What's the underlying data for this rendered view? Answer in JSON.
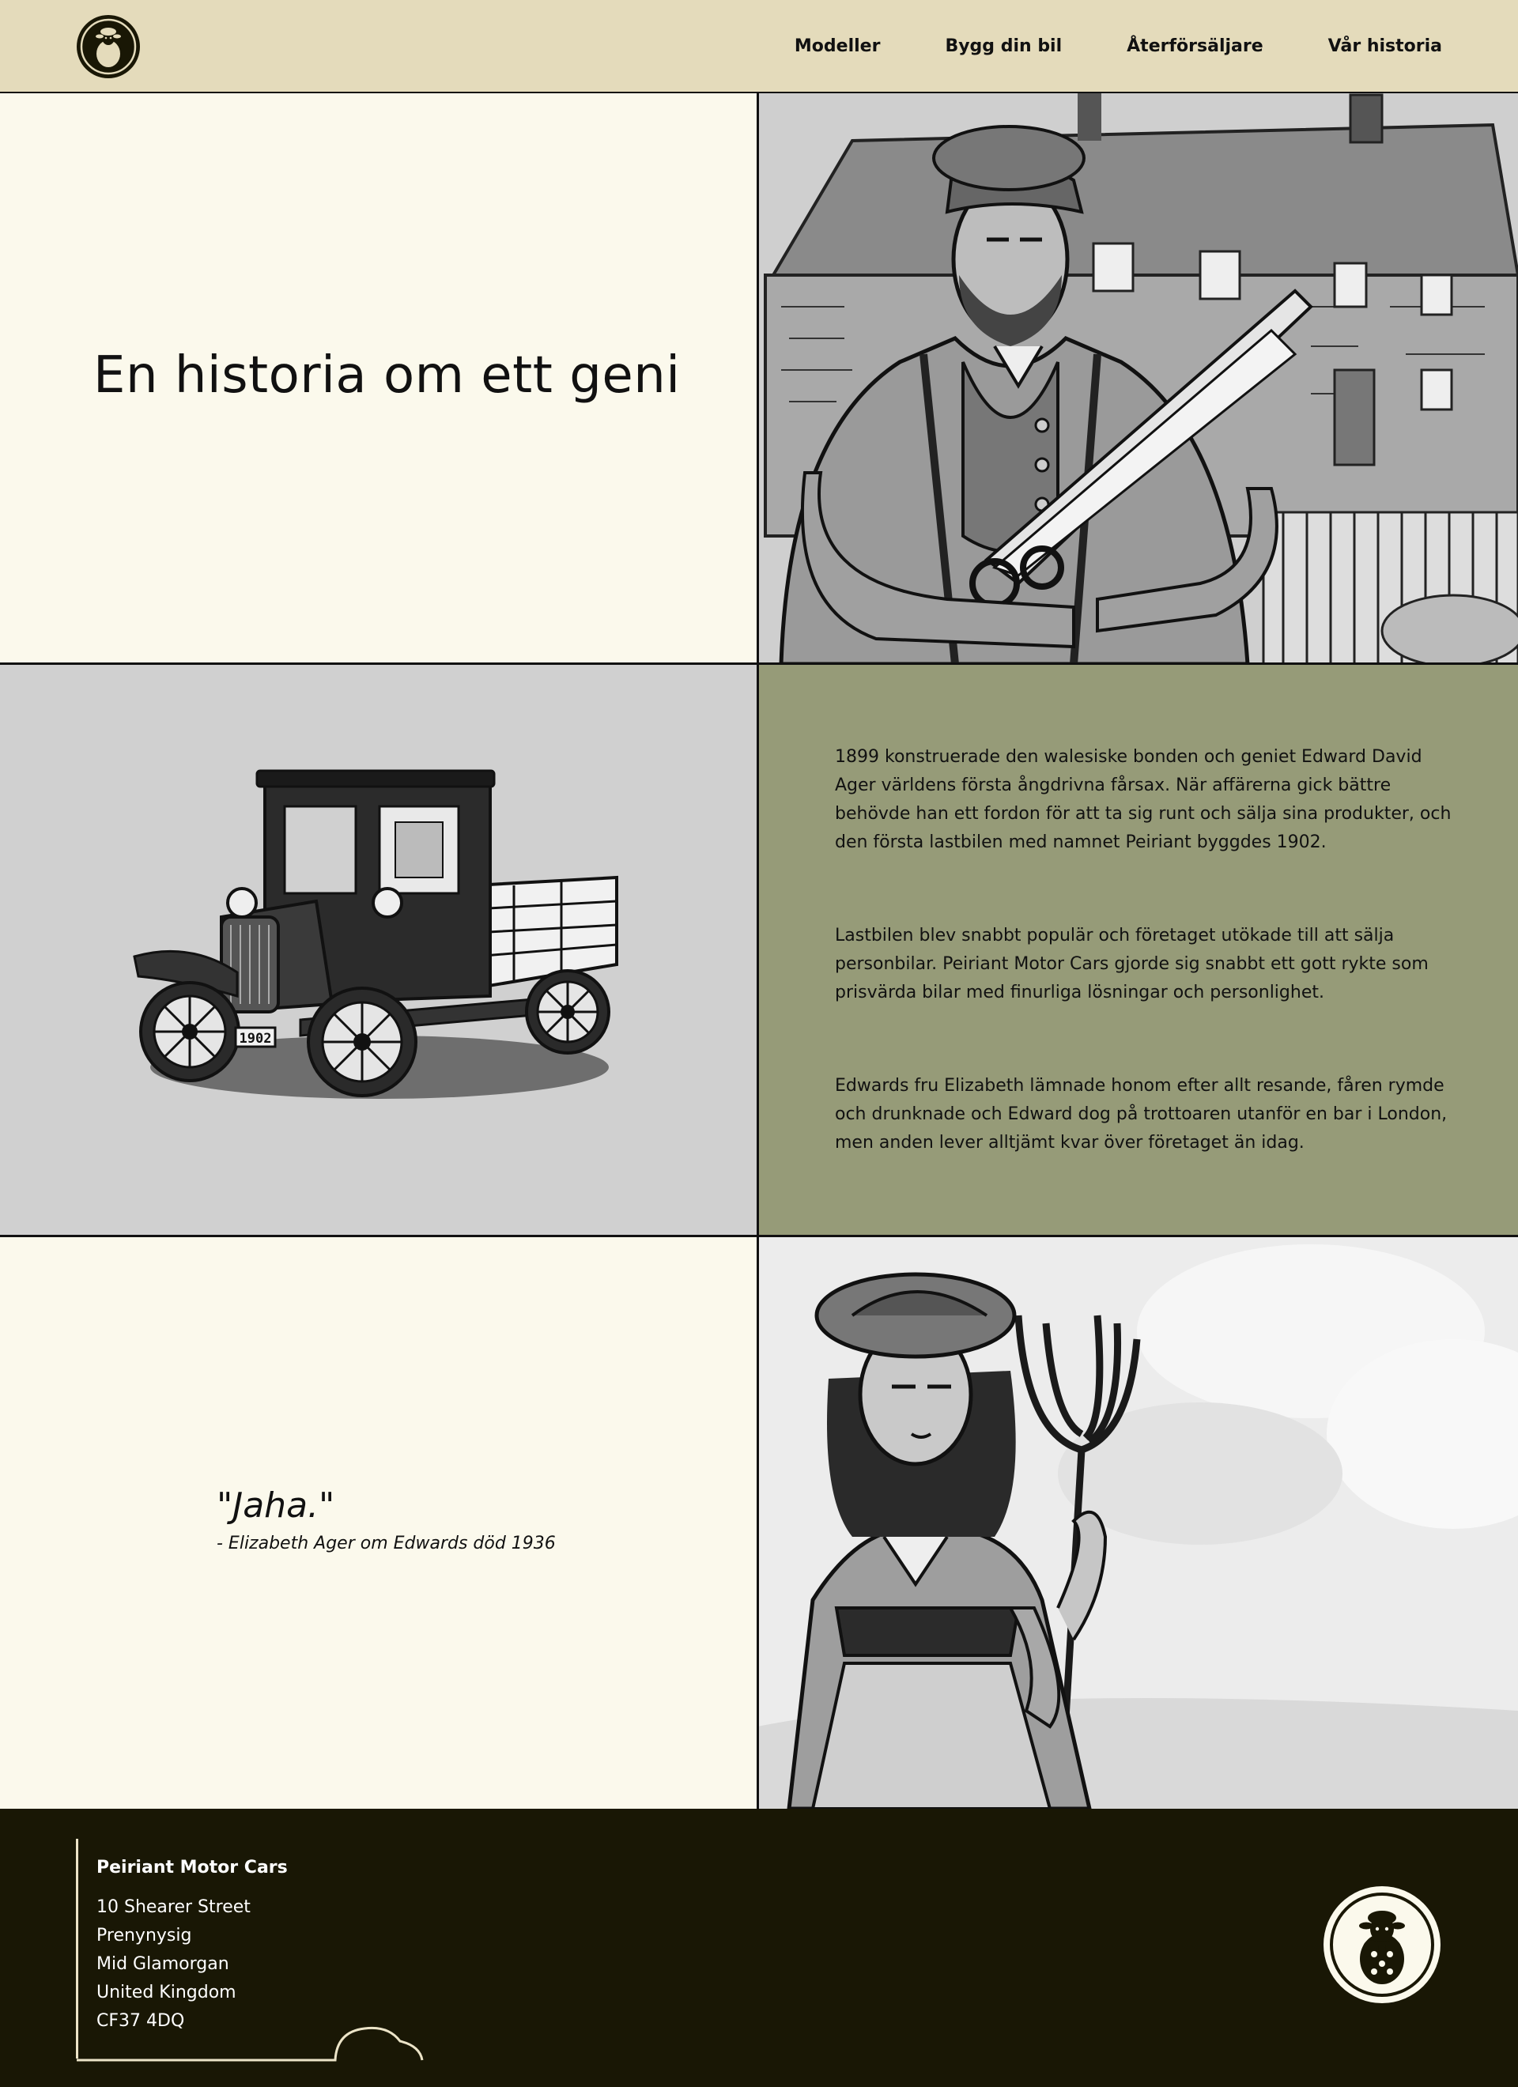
{
  "nav": {
    "logo_icon": "sheep-logo-icon",
    "links": [
      "Modeller",
      "Bygg din bil",
      "Återförsäljare",
      "Vår historia"
    ]
  },
  "hero": {
    "title": "En historia om ett geni",
    "image": "farmer-with-shears-illustration"
  },
  "story": {
    "image": "vintage-truck-1902-illustration",
    "plate": "1902",
    "paragraphs": [
      "1899 konstruerade den walesiske bonden och geniet Edward David Ager världens första ångdrivna fårsax. När affärerna gick bättre behövde han ett fordon för att ta sig runt och sälja sina produkter, och den första lastbilen med namnet Peiriant byggdes 1902.",
      "Lastbilen blev snabbt populär och företaget utökade till att sälja personbilar. Peiriant Motor Cars gjorde sig snabbt ett gott rykte som prisvärda bilar med finurliga lösningar och personlighet.",
      "Edwards fru Elizabeth lämnade honom efter allt resande, fåren rymde och drunknade och Edward dog på trottoaren utanför en bar i London, men anden lever alltjämt kvar över företaget än idag."
    ]
  },
  "quote": {
    "text": "\"Jaha.\"",
    "cite": "- Elizabeth Ager om Edwards död 1936",
    "image": "woman-with-pitchfork-illustration"
  },
  "footer": {
    "company": "Peiriant Motor Cars",
    "address": [
      "10 Shearer Street",
      "Prenynysig",
      "Mid Glamorgan",
      "United Kingdom",
      "CF37 4DQ"
    ],
    "logo_icon": "sheep-logo-icon"
  },
  "colors": {
    "nav_bg": "#e4dbbb",
    "cream": "#fbf9ec",
    "green": "#969b78",
    "gray": "#d0d0d0",
    "footer_bg": "#191705"
  }
}
